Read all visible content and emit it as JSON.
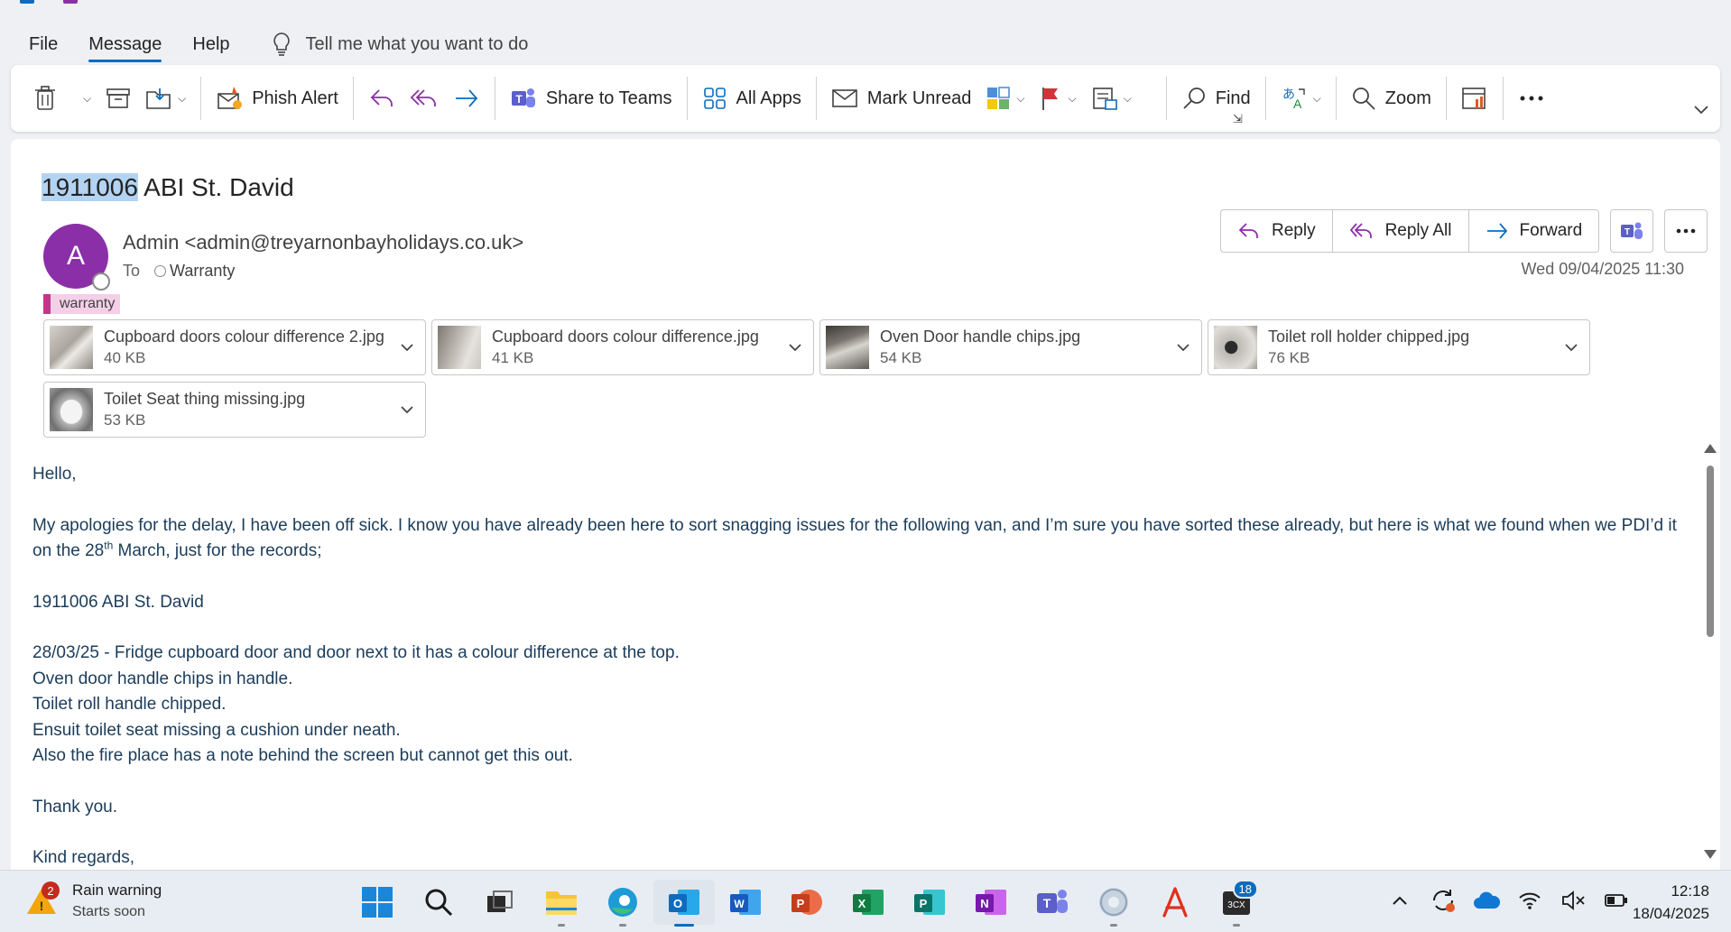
{
  "menu": {
    "file": "File",
    "message": "Message",
    "help": "Help",
    "tell_me": "Tell me what you want to do"
  },
  "ribbon": {
    "phish_alert": "Phish Alert",
    "share_to_teams": "Share to Teams",
    "all_apps": "All Apps",
    "mark_unread": "Mark Unread",
    "find": "Find",
    "zoom": "Zoom"
  },
  "email": {
    "subject_highlight": "1911006",
    "subject_rest": " ABI St. David",
    "avatar_initial": "A",
    "sender": "Admin <admin@treyarnonbayholidays.co.uk>",
    "to_label": "To",
    "recipient": "Warranty",
    "category": "warranty",
    "date": "Wed 09/04/2025 11:30",
    "actions": {
      "reply": "Reply",
      "reply_all": "Reply All",
      "forward": "Forward"
    },
    "attachments": [
      {
        "name": "Cupboard doors colour difference 2.jpg",
        "size": "40 KB"
      },
      {
        "name": "Cupboard doors colour difference.jpg",
        "size": "41 KB"
      },
      {
        "name": "Oven Door handle chips.jpg",
        "size": "54 KB"
      },
      {
        "name": "Toilet roll holder chipped.jpg",
        "size": "76 KB"
      },
      {
        "name": "Toilet Seat thing missing.jpg",
        "size": "53 KB"
      }
    ],
    "body": {
      "greeting": "Hello,",
      "para1_a": "My apologies for the delay, I have been off sick. I know you have already been here to sort snagging issues for the following van, and I’m sure you have sorted these already, but here is what we found when we PDI’d it on the 28",
      "para1_sup": "th",
      "para1_b": " March, just for the records;",
      "van": "1911006 ABI St. David",
      "lines": [
        "28/03/25 - Fridge cupboard door and door next to it has a colour difference at the top.",
        "Oven door handle chips in handle.",
        "Toilet roll handle chipped.",
        "Ensuit toilet seat missing a cushion under neath.",
        "Also the fire place has a note behind the screen but cannot get this out."
      ],
      "thanks": "Thank you.",
      "regards": "Kind regards,"
    }
  },
  "taskbar": {
    "weather_badge": "2",
    "weather_title": "Rain warning",
    "weather_sub": "Starts soon",
    "notification_badge": "18",
    "time": "12:18",
    "date": "18/04/2025"
  },
  "colors": {
    "accent": "#0f6cbd",
    "avatar": "#8b2fa8",
    "category": "#f4cfe8",
    "body_text": "#1b3c5a",
    "selection": "#b3d3f2"
  }
}
